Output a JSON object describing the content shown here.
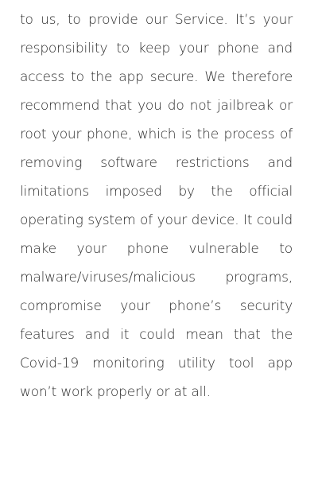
{
  "policy": {
    "paragraph": "to us, to provide our Service. It’s your responsibility to keep your phone and access to the app secure. We therefore recommend that you do not jailbreak or root your phone, which is the process of removing software restrictions and limitations imposed by the official operating system of your device. It could make your phone vulnerable to malware/viruses/malicious programs, compromise your phone’s security features and it could mean that the Covid-19 monitoring utility tool app won’t work properly or at all."
  }
}
